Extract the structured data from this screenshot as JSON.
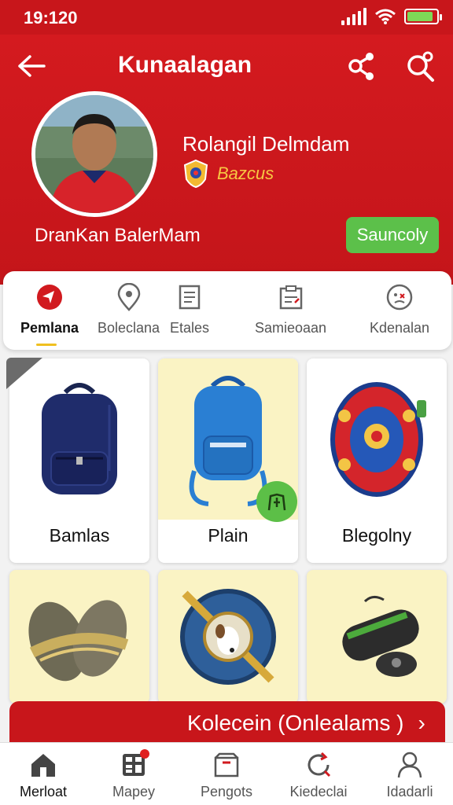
{
  "status_bar": {
    "time": "19:120",
    "battery_level": 0.9
  },
  "header": {
    "title": "Kunaalagan",
    "profile_name": "Rolangil Delmdam",
    "badge_label": "Bazcus",
    "profile_subtitle": "DranKan BalerMam",
    "action_button": "Sauncoly"
  },
  "tabs": [
    {
      "label": "Pemlana",
      "icon": "target-icon",
      "active": true
    },
    {
      "label": "Boleclana",
      "icon": "location-pin-icon"
    },
    {
      "label": "Etales",
      "icon": "document-icon"
    },
    {
      "label": "Samieoaan",
      "icon": "clipboard-icon"
    },
    {
      "label": "Kdenalan",
      "icon": "face-icon"
    }
  ],
  "products": [
    {
      "label": "Bamlas"
    },
    {
      "label": "Plain"
    },
    {
      "label": "Blegolny"
    }
  ],
  "banner": {
    "text": "Kolecein (Onlealams )"
  },
  "bottom_nav": [
    {
      "label": "Merloat",
      "icon": "home-icon",
      "active": true
    },
    {
      "label": "Mapey",
      "icon": "calculator-icon"
    },
    {
      "label": "Pengots",
      "icon": "box-icon"
    },
    {
      "label": "Kiedeclai",
      "icon": "refresh-icon"
    },
    {
      "label": "Idadarli",
      "icon": "user-icon"
    }
  ],
  "colors": {
    "primary_red": "#c8161b",
    "accent_green": "#5cc04a",
    "accent_yellow": "#f7c843",
    "card_yellow": "#faf3c4"
  }
}
